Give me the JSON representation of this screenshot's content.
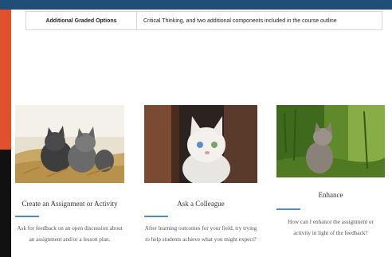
{
  "table": {
    "row_label": "Additional Graded Options",
    "row_value": "Critical Thinking, and two additional components included in the course outline"
  },
  "cards": [
    {
      "title": "Create an Assignment or Activity",
      "desc": "Ask for feedback on an open discussion about an assignment and/or a lesson plan."
    },
    {
      "title": "Ask a Colleague",
      "desc": "After learning outcomes for your field, try trying to help students achieve what you might expect?"
    },
    {
      "title": "Enhance",
      "desc": "How can I enhance the assignment or activity in light of the feedback?"
    }
  ],
  "colors": {
    "accent": "#4a8ad0",
    "top_bar": "#1f4e79",
    "left_strip": "#e2502c"
  }
}
